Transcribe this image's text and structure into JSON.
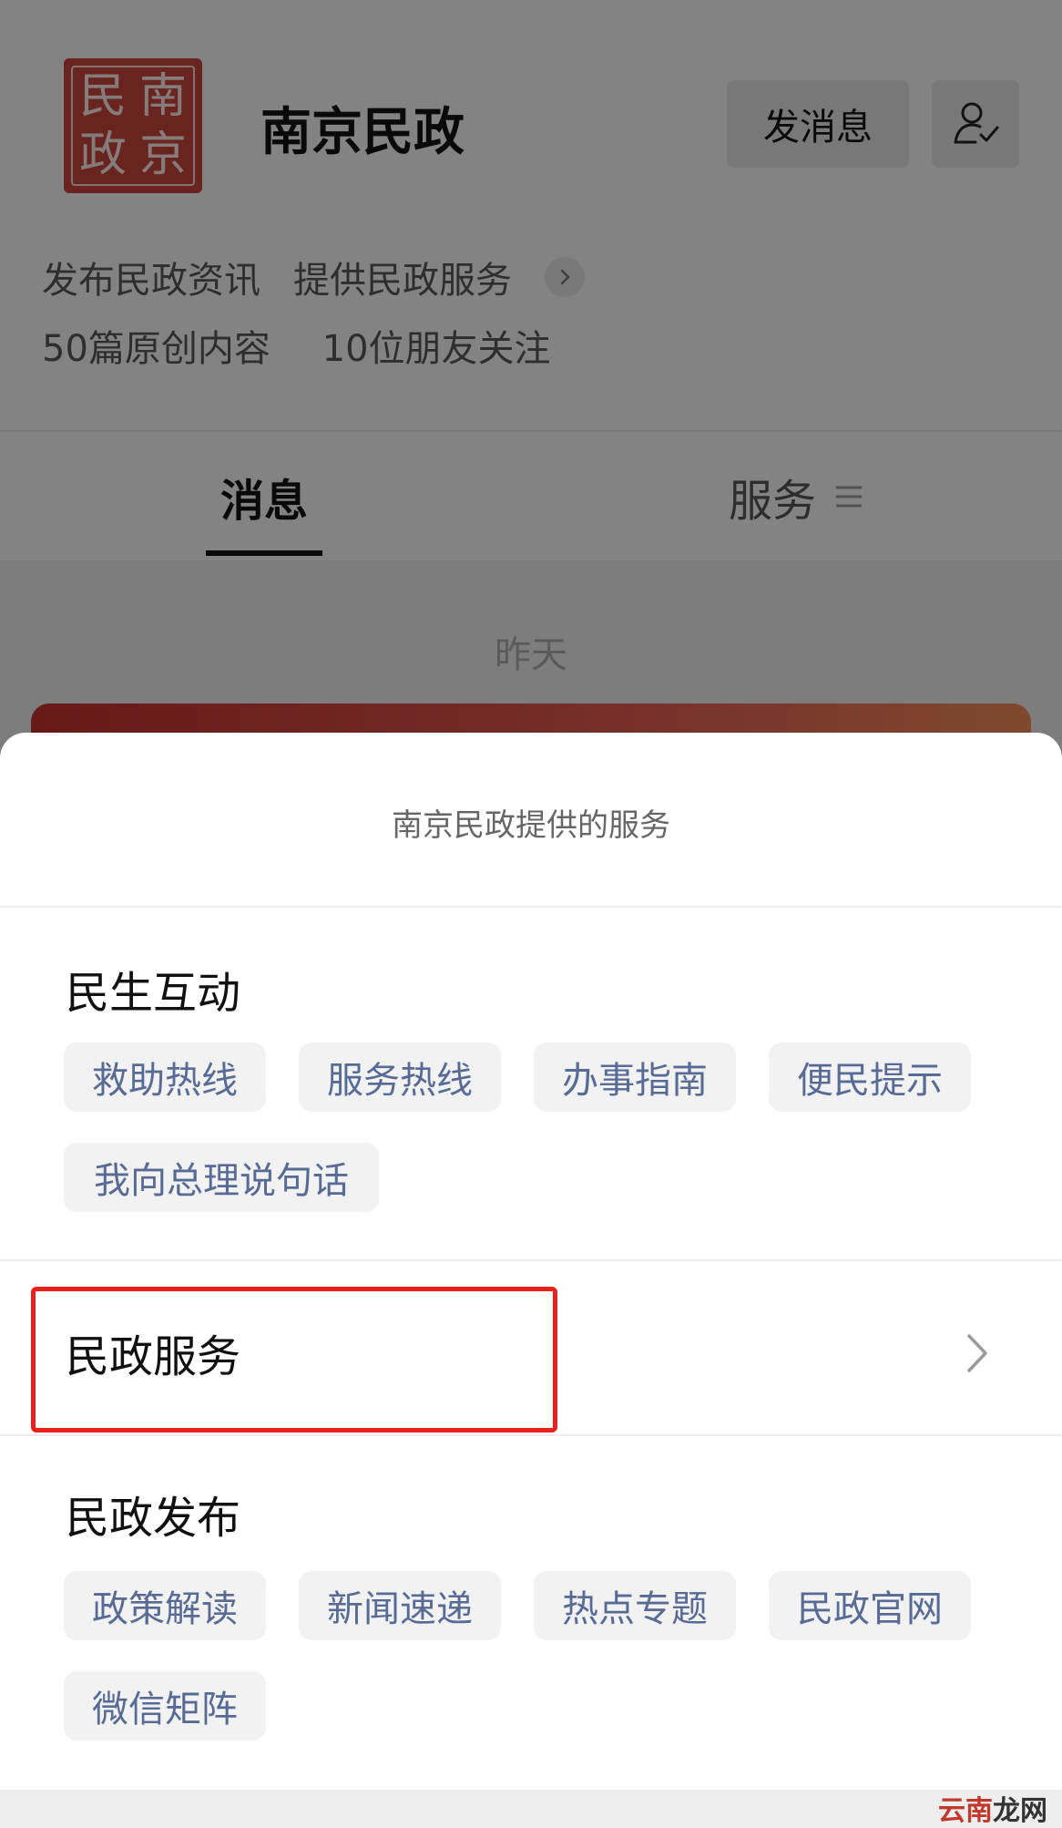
{
  "profile": {
    "logo_chars": [
      "民",
      "南",
      "政",
      "京"
    ],
    "name": "南京民政",
    "message_button": "发消息",
    "intro_items": [
      "发布民政资讯",
      "提供民政服务"
    ],
    "stats": [
      "50篇原创内容",
      "10位朋友关注"
    ]
  },
  "tabs": [
    {
      "label": "消息",
      "active": true
    },
    {
      "label": "服务",
      "active": false
    }
  ],
  "feed": {
    "date_label": "昨天"
  },
  "sheet": {
    "title": "南京民政提供的服务",
    "sections": [
      {
        "title": "民生互动",
        "items": [
          "救助热线",
          "服务热线",
          "办事指南",
          "便民提示",
          "我向总理说句话"
        ]
      },
      {
        "title": "民政服务",
        "items": []
      },
      {
        "title": "民政发布",
        "items": [
          "政策解读",
          "新闻速递",
          "热点专题",
          "民政官网",
          "微信矩阵"
        ]
      }
    ]
  },
  "watermark": {
    "part1": "云南",
    "part2": "龙网"
  },
  "colors": {
    "link_blue": "#576b95",
    "highlight_red": "#e8211d",
    "logo_red": "#c9453c"
  },
  "icons": [
    "chevron-right-icon",
    "follow-check-icon",
    "menu-lines-icon"
  ]
}
